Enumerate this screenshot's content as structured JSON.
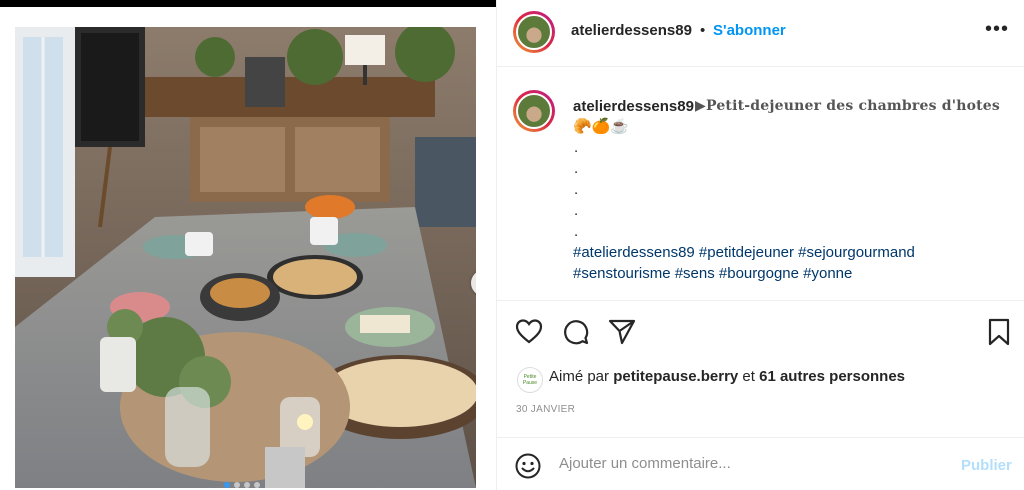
{
  "post": {
    "username": "atelierdessens89",
    "separator": "•",
    "follow_label": "S'abonner",
    "more_label": "•••",
    "caption": {
      "username": "atelierdessens89",
      "title": "▶Petit-dejeuner des chambres d'hotes",
      "emojis": "🥐🍊☕",
      "dot_lines": [
        ".",
        ".",
        ".",
        ".",
        "."
      ],
      "hashtags_line1": "#atelierdessens89 #petitdejeuner #sejourgourmand",
      "hashtags_line2": "#senstourisme #sens #bourgogne #yonne"
    },
    "likes": {
      "prefix": "Aimé par",
      "liker": "petitepause.berry",
      "connector": "et",
      "others": "61 autres personnes",
      "liker_avatar_text": "Petite Pause"
    },
    "date": "30 JANVIER",
    "comment": {
      "placeholder": "Ajouter un commentaire...",
      "publish_label": "Publier"
    },
    "carousel": {
      "next_label": "›",
      "slide_count": 4,
      "active_index": 0
    },
    "colors": {
      "follow": "#0095f6",
      "hashtag": "#00376b",
      "publish_disabled": "#b2dffc",
      "date": "#8e8e8e"
    }
  }
}
